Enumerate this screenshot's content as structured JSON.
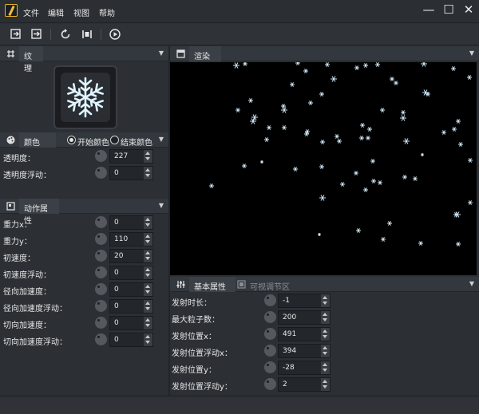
{
  "menu": {
    "items": [
      "文件",
      "编辑",
      "视图",
      "帮助"
    ]
  },
  "window_controls": {
    "minimize": "—",
    "maximize": "☐",
    "close": "✕"
  },
  "texture_panel": {
    "title": "纹理"
  },
  "color_panel": {
    "title": "颜色",
    "start_color": "开始颜色",
    "end_color": "结束颜色",
    "props": [
      {
        "label": "透明度：",
        "value": "227"
      },
      {
        "label": "透明度浮动：",
        "value": "0"
      }
    ]
  },
  "motion_panel": {
    "title": "动作属性",
    "props": [
      {
        "label": "重力x：",
        "value": "0"
      },
      {
        "label": "重力y：",
        "value": "110"
      },
      {
        "label": "初速度：",
        "value": "20"
      },
      {
        "label": "初速度浮动：",
        "value": "0"
      },
      {
        "label": "径向加速度：",
        "value": "0"
      },
      {
        "label": "径向加速度浮动：",
        "value": "0"
      },
      {
        "label": "切向加速度：",
        "value": "0"
      },
      {
        "label": "切向加速度浮动：",
        "value": "0"
      }
    ]
  },
  "render_panel": {
    "title": "渲染区"
  },
  "basic_panel": {
    "tab_basic": "基本属性",
    "tab_visual": "可视调节区",
    "props": [
      {
        "label": "发射时长：",
        "value": "-1"
      },
      {
        "label": "最大粒子数：",
        "value": "200"
      },
      {
        "label": "发射位置x：",
        "value": "491"
      },
      {
        "label": "发射位置浮动x：",
        "value": "394"
      },
      {
        "label": "发射位置y：",
        "value": "-28"
      },
      {
        "label": "发射位置浮动y：",
        "value": "2"
      }
    ]
  },
  "colors": {
    "accent": "#e8b52c",
    "panel": "#2c3035",
    "header": "#33383e",
    "render_bg": "#000000"
  }
}
